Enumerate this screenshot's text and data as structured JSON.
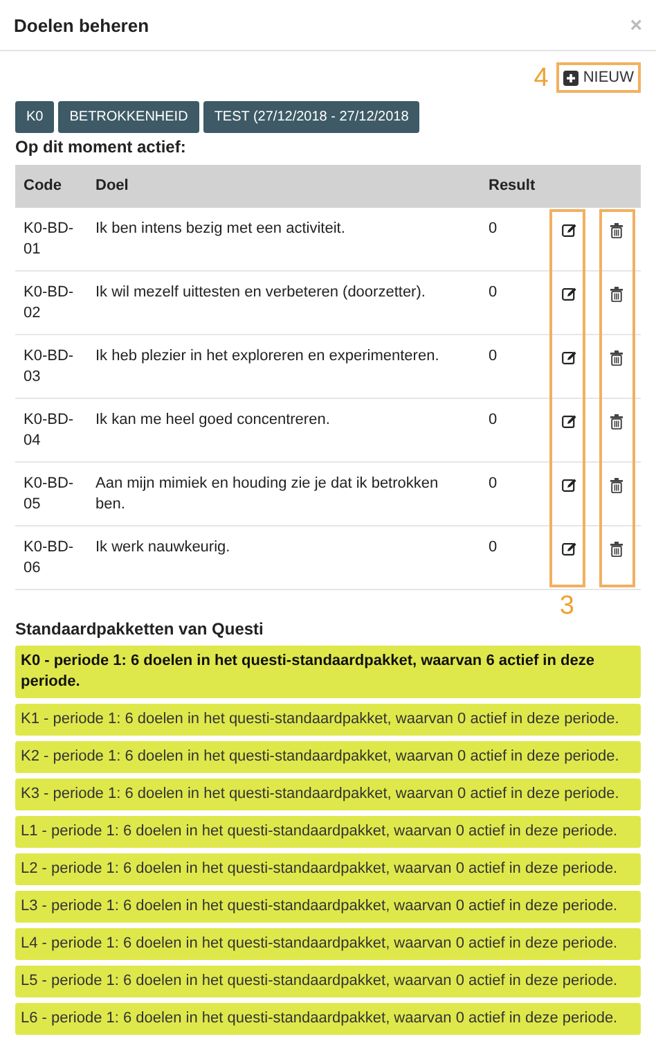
{
  "dialog": {
    "title": "Doelen beheren",
    "close": "×"
  },
  "new_button": {
    "label": "NIEUW",
    "annotation": "4"
  },
  "filters": [
    {
      "label": "K0"
    },
    {
      "label": "BETROKKENHEID"
    },
    {
      "label": "TEST (27/12/2018 - 27/12/2018"
    }
  ],
  "active_title": "Op dit moment actief:",
  "table": {
    "columns": [
      "Code",
      "Doel",
      "Result"
    ],
    "actions_annotation": "3",
    "rows": [
      {
        "code": "K0-BD-01",
        "goal": "Ik ben intens bezig met een activiteit.",
        "result": "0"
      },
      {
        "code": "K0-BD-02",
        "goal": "Ik wil mezelf uittesten en verbeteren (doorzetter).",
        "result": "0"
      },
      {
        "code": "K0-BD-03",
        "goal": "Ik heb plezier in het exploreren en experimenteren.",
        "result": "0"
      },
      {
        "code": "K0-BD-04",
        "goal": "Ik kan me heel goed concentreren.",
        "result": "0"
      },
      {
        "code": "K0-BD-05",
        "goal": "Aan mijn mimiek en houding zie je dat ik betrokken ben.",
        "result": "0"
      },
      {
        "code": "K0-BD-06",
        "goal": "Ik werk nauwkeurig.",
        "result": "0"
      }
    ]
  },
  "packages_title": "Standaardpakketten van Questi",
  "packages": [
    {
      "text": "K0 - periode 1: 6 doelen in het questi-standaardpakket, waarvan 6 actief in deze periode.",
      "active": true
    },
    {
      "text": "K1 - periode 1: 6 doelen in het questi-standaardpakket, waarvan 0 actief in deze periode.",
      "active": false
    },
    {
      "text": "K2 - periode 1: 6 doelen in het questi-standaardpakket, waarvan 0 actief in deze periode.",
      "active": false
    },
    {
      "text": "K3 - periode 1: 6 doelen in het questi-standaardpakket, waarvan 0 actief in deze periode.",
      "active": false
    },
    {
      "text": "L1 - periode 1: 6 doelen in het questi-standaardpakket, waarvan 0 actief in deze periode.",
      "active": false
    },
    {
      "text": "L2 - periode 1: 6 doelen in het questi-standaardpakket, waarvan 0 actief in deze periode.",
      "active": false
    },
    {
      "text": "L3 - periode 1: 6 doelen in het questi-standaardpakket, waarvan 0 actief in deze periode.",
      "active": false
    },
    {
      "text": "L4 - periode 1: 6 doelen in het questi-standaardpakket, waarvan 0 actief in deze periode.",
      "active": false
    },
    {
      "text": "L5 - periode 1: 6 doelen in het questi-standaardpakket, waarvan 0 actief in deze periode.",
      "active": false
    },
    {
      "text": "L6 - periode 1: 6 doelen in het questi-standaardpakket, waarvan 0 actief in deze periode.",
      "active": false
    }
  ]
}
